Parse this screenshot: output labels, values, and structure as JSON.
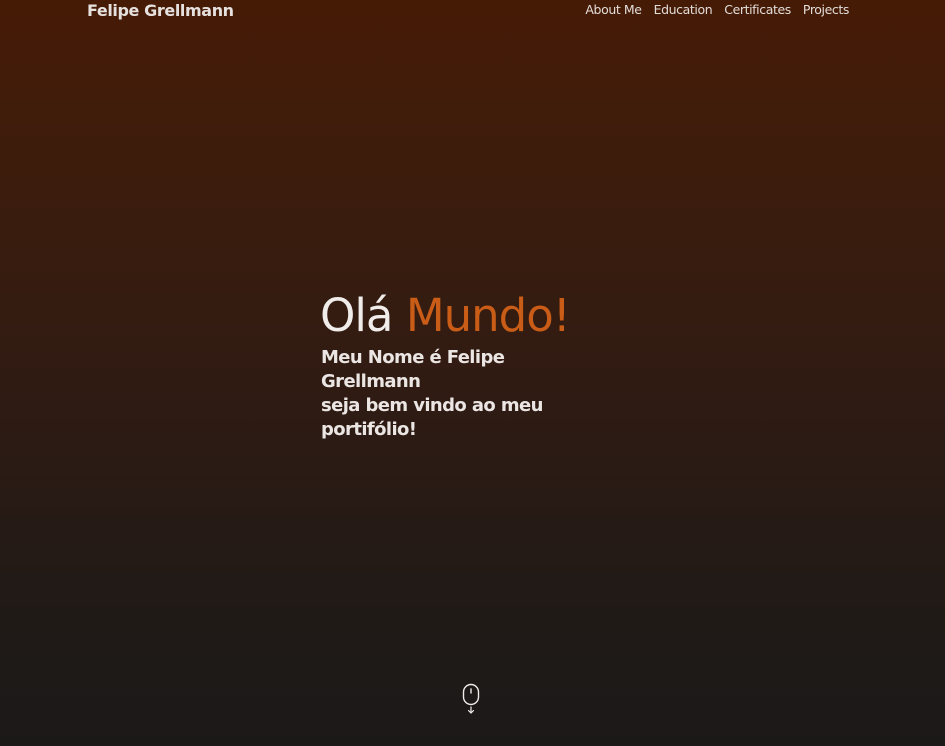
{
  "header": {
    "brand": "Felipe Grellmann",
    "nav": [
      {
        "label": "About Me"
      },
      {
        "label": "Education"
      },
      {
        "label": "Certificates"
      },
      {
        "label": "Projects"
      }
    ]
  },
  "hero": {
    "greeting": "Olá",
    "greeting_accent": "Mundo!",
    "line1": "Meu Nome é Felipe Grellmann",
    "line2": "seja bem vindo ao meu",
    "line3": "portifólio!"
  },
  "scroll_indicator": {
    "icon": "mouse-scroll-down-icon"
  },
  "colors": {
    "accent": "#c95c16",
    "background_top": "#461b06",
    "background_bottom": "#1b1918",
    "text": "#ebe6e3"
  }
}
